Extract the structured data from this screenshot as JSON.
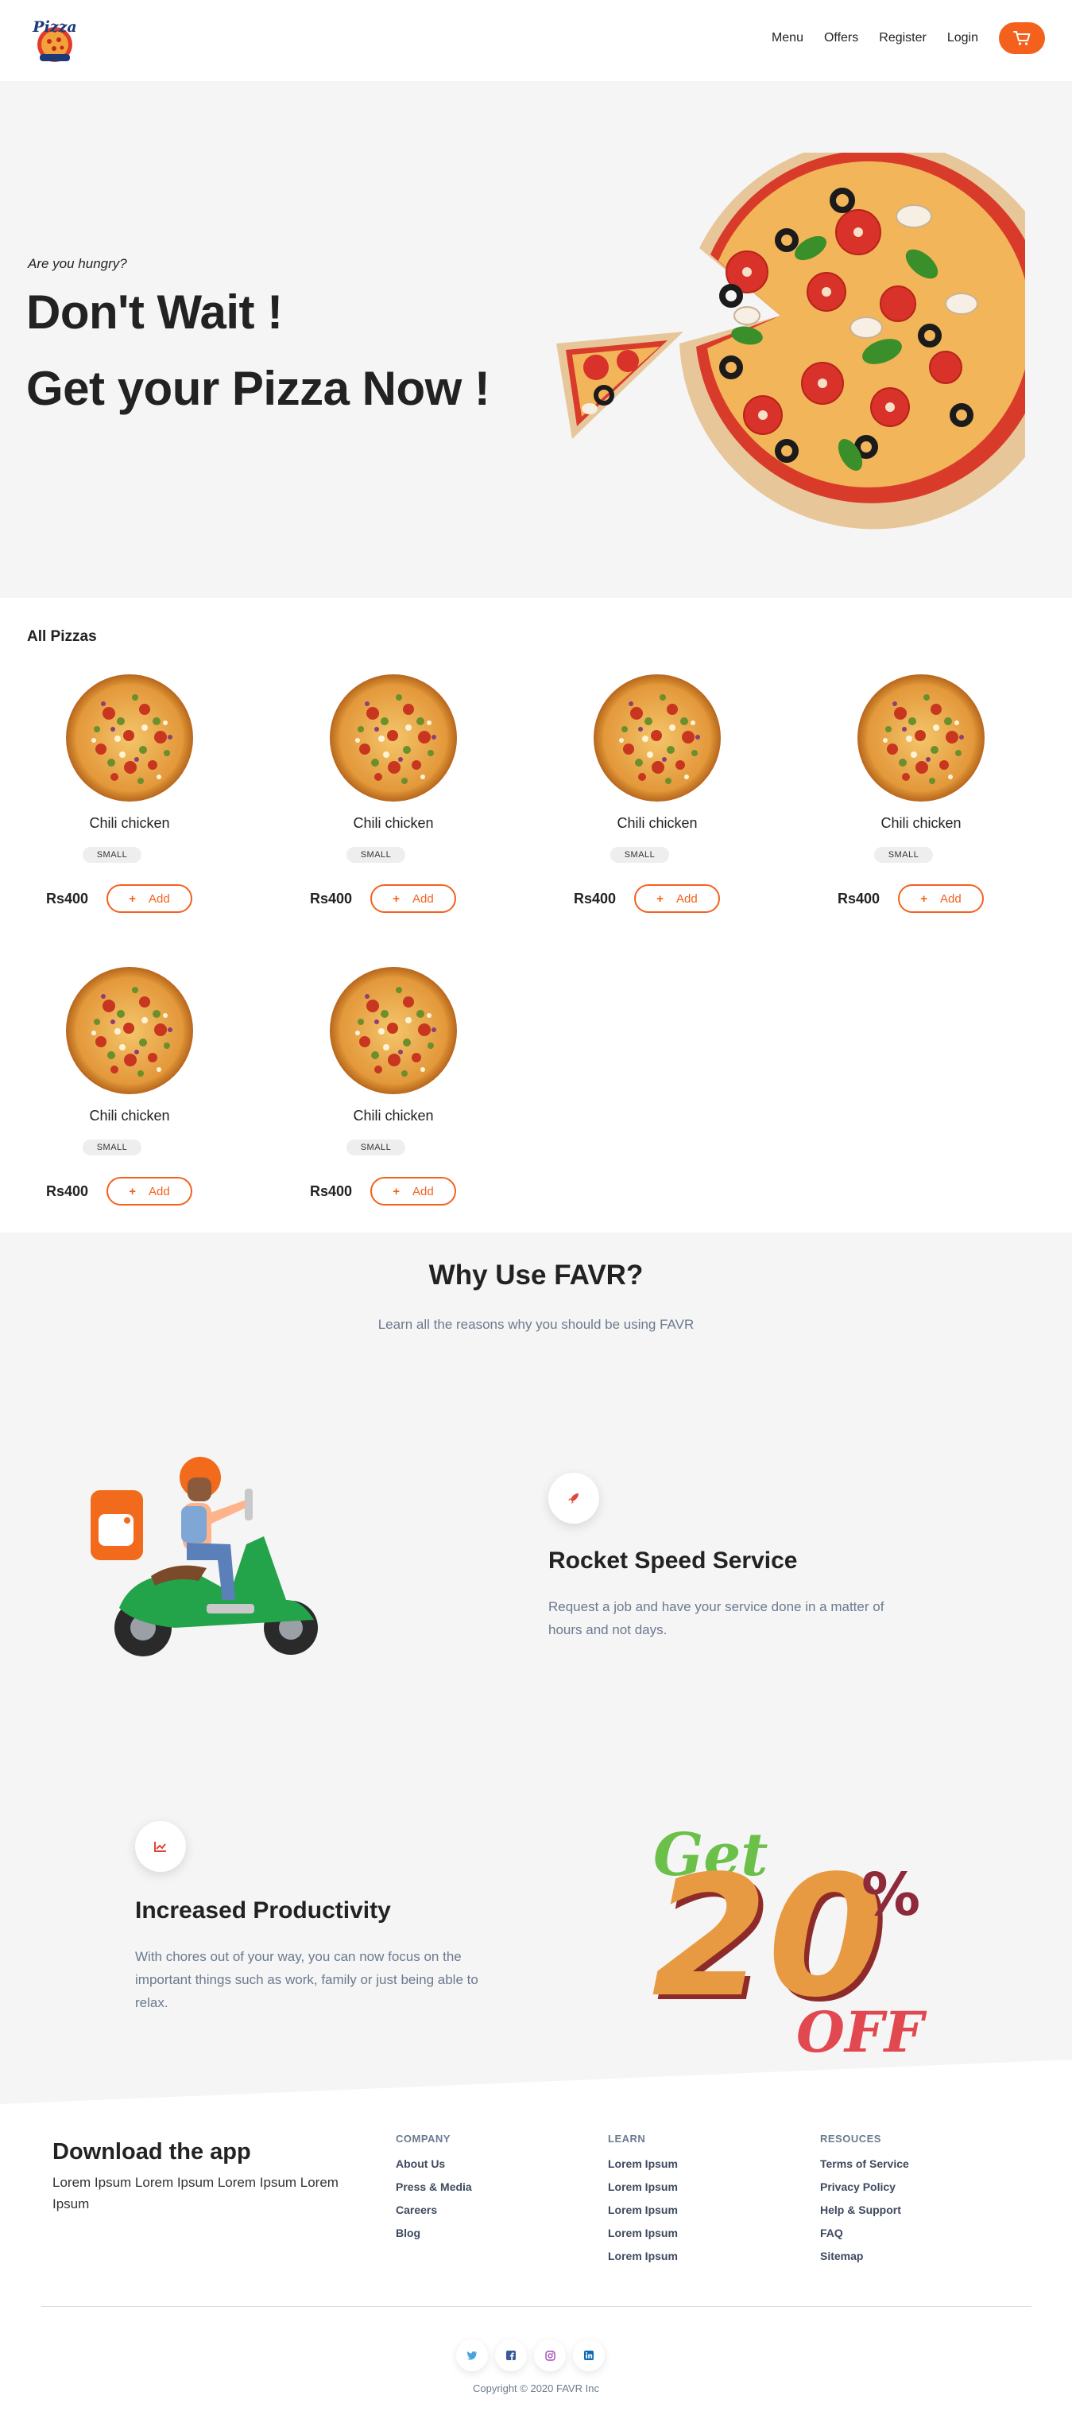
{
  "nav": {
    "logo_text": "Pizza",
    "links": [
      "Menu",
      "Offers",
      "Register",
      "Login"
    ],
    "cart_icon": "cart-icon"
  },
  "hero": {
    "tagline": "Are you hungry?",
    "line1": "Don't Wait !",
    "line2": "Get your Pizza Now !"
  },
  "pizzas": {
    "title": "All Pizzas",
    "add_symbol": "+",
    "items": [
      {
        "name": "Chili chicken",
        "size": "SMALL",
        "price": "Rs400",
        "add_label": "Add"
      },
      {
        "name": "Chili chicken",
        "size": "SMALL",
        "price": "Rs400",
        "add_label": "Add"
      },
      {
        "name": "Chili chicken",
        "size": "SMALL",
        "price": "Rs400",
        "add_label": "Add"
      },
      {
        "name": "Chili chicken",
        "size": "SMALL",
        "price": "Rs400",
        "add_label": "Add"
      },
      {
        "name": "Chili chicken",
        "size": "SMALL",
        "price": "Rs400",
        "add_label": "Add"
      },
      {
        "name": "Chili chicken",
        "size": "SMALL",
        "price": "Rs400",
        "add_label": "Add"
      }
    ]
  },
  "why": {
    "title": "Why Use FAVR?",
    "subtitle": "Learn all the reasons why you should be using FAVR",
    "features": [
      {
        "title": "Rocket Speed Service",
        "desc": "Request a job and have your service done in a matter of hours and not days.",
        "icon": "rocket-icon"
      },
      {
        "title": "Increased Productivity",
        "desc": "With chores out of your way, you can now focus on the important things such as work, family or just being able to relax.",
        "icon": "chart-icon"
      }
    ],
    "promo": {
      "top": "Get",
      "number": "20",
      "percent": "%",
      "bottom": "OFF"
    }
  },
  "footer": {
    "download_title": "Download the app",
    "download_text": "Lorem Ipsum Lorem Ipsum Lorem Ipsum Lorem Ipsum",
    "columns": [
      {
        "heading": "COMPANY",
        "links": [
          "About Us",
          "Press & Media",
          "Careers",
          "Blog"
        ]
      },
      {
        "heading": "LEARN",
        "links": [
          "Lorem Ipsum",
          "Lorem Ipsum",
          "Lorem Ipsum",
          "Lorem Ipsum",
          "Lorem Ipsum"
        ]
      },
      {
        "heading": "RESOUCES",
        "links": [
          "Terms of Service",
          "Privacy Policy",
          "Help & Support",
          "FAQ",
          "Sitemap"
        ]
      }
    ],
    "socials": [
      "twitter-icon",
      "facebook-icon",
      "instagram-icon",
      "linkedin-icon"
    ],
    "copyright": "Copyright © 2020 FAVR Inc"
  },
  "colors": {
    "accent": "#f4611d",
    "muted_text": "#6b7a8f",
    "section_bg": "#f5f5f5"
  }
}
